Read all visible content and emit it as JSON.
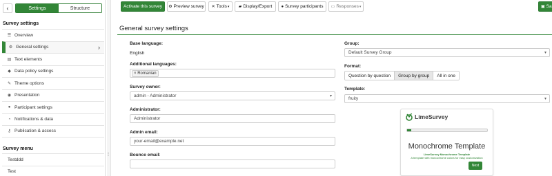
{
  "sidebar": {
    "back_icon": "chevron-left-icon",
    "tabs": [
      {
        "label": "Settings",
        "active": true
      },
      {
        "label": "Structure",
        "active": false
      }
    ],
    "settings_title": "Survey settings",
    "items": [
      {
        "label": "Overview",
        "icon": "list-icon"
      },
      {
        "label": "General settings",
        "icon": "cogs-icon",
        "active": true
      },
      {
        "label": "Text elements",
        "icon": "file-text-icon"
      },
      {
        "label": "Data policy settings",
        "icon": "shield-icon"
      },
      {
        "label": "Theme options",
        "icon": "paint-brush-icon"
      },
      {
        "label": "Presentation",
        "icon": "eye-icon"
      },
      {
        "label": "Participant settings",
        "icon": "users-icon"
      },
      {
        "label": "Notifications & data",
        "icon": "feed-icon"
      },
      {
        "label": "Publication & access",
        "icon": "key-icon"
      }
    ],
    "menu_title": "Survey menu",
    "menu_items": [
      {
        "label": "Testddd"
      },
      {
        "label": "Test"
      }
    ]
  },
  "toolbar": {
    "activate": "Activate this survey",
    "preview": "Preview survey",
    "tools": "Tools",
    "display_export": "Display/Export",
    "participants": "Survey participants",
    "responses": "Responses",
    "save": "Sa"
  },
  "main": {
    "title": "General survey settings",
    "base_language_label": "Base language:",
    "base_language_value": "English",
    "additional_languages_label": "Additional languages:",
    "additional_languages_tag": "Romanian",
    "survey_owner_label": "Survey owner:",
    "survey_owner_value": "admin - Administrator",
    "administrator_label": "Administrator:",
    "administrator_value": "Administrator",
    "admin_email_label": "Admin email:",
    "admin_email_value": "your-email@example.net",
    "bounce_email_label": "Bounce email:",
    "bounce_email_value": "",
    "group_label": "Group:",
    "group_value": "Default Survey Group",
    "format_label": "Format:",
    "format_options": [
      "Question by question",
      "Group by group",
      "All in one"
    ],
    "format_selected": "Group by group",
    "template_label": "Template:",
    "template_value": "fruity"
  },
  "preview": {
    "logo_text": "LimeSurvey",
    "title": "Monochrome Template",
    "subtitle1": "LimeSurvey Monochrome Template",
    "subtitle2": "A template with monochrome colors for easy customization",
    "next": "Next"
  },
  "colors": {
    "accent": "#328637",
    "border": "#cccccc"
  }
}
